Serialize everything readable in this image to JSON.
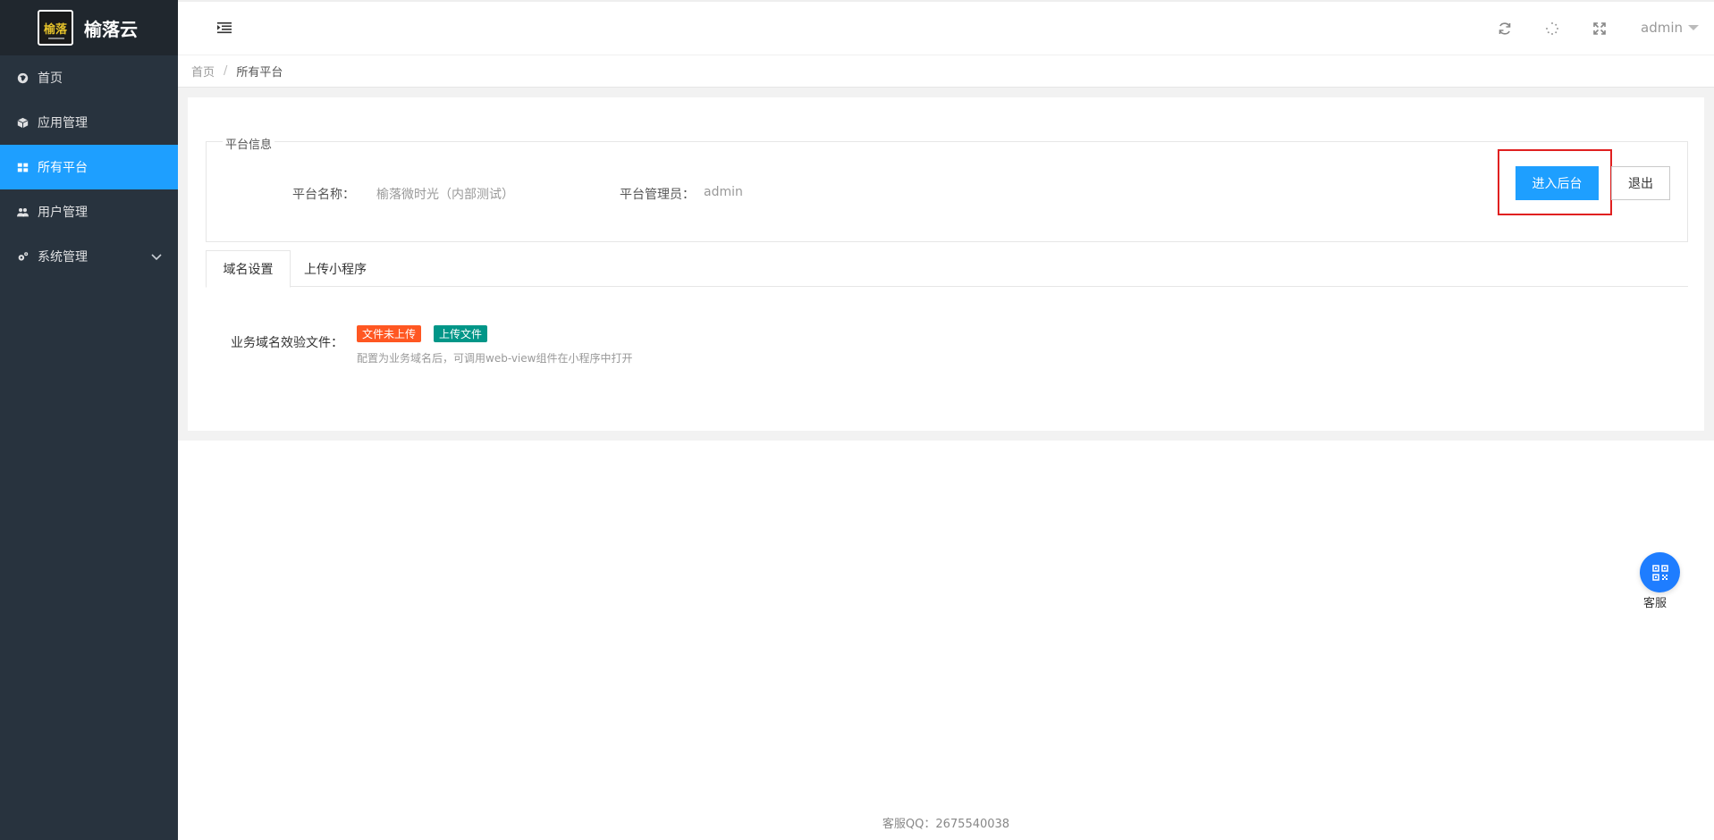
{
  "sidebar": {
    "logo_text": "榆落",
    "brand": "榆落云",
    "items": [
      {
        "label": "首页",
        "icon": "globe-icon"
      },
      {
        "label": "应用管理",
        "icon": "cube-icon"
      },
      {
        "label": "所有平台",
        "icon": "grid-icon",
        "active": true
      },
      {
        "label": "用户管理",
        "icon": "users-icon"
      },
      {
        "label": "系统管理",
        "icon": "cogs-icon",
        "has_submenu": true
      }
    ]
  },
  "header": {
    "user": "admin",
    "icons": [
      "menu-toggle-icon",
      "refresh-icon",
      "loading-icon",
      "fullscreen-icon"
    ]
  },
  "breadcrumb": {
    "home": "首页",
    "separator": "/",
    "current": "所有平台"
  },
  "platform_info": {
    "legend": "平台信息",
    "name_label": "平台名称：",
    "name_value": "榆落微时光（内部测试）",
    "admin_label": "平台管理员：",
    "admin_value": "admin",
    "enter_button": "进入后台",
    "exit_button": "退出"
  },
  "tabs": [
    {
      "label": "域名设置",
      "active": true
    },
    {
      "label": "上传小程序"
    }
  ],
  "domain_settings": {
    "label": "业务域名效验文件：",
    "status_badge": "文件未上传",
    "upload_button": "上传文件",
    "hint": "配置为业务域名后，可调用web-view组件在小程序中打开"
  },
  "service": {
    "label": "客服"
  },
  "footer": {
    "text": "客服QQ：2675540038"
  },
  "colors": {
    "sidebar_bg": "#28333e",
    "logo_bg": "#20272e",
    "primary": "#1e9fff",
    "orange": "#ff5722",
    "green": "#009688",
    "highlight": "#e02020"
  }
}
